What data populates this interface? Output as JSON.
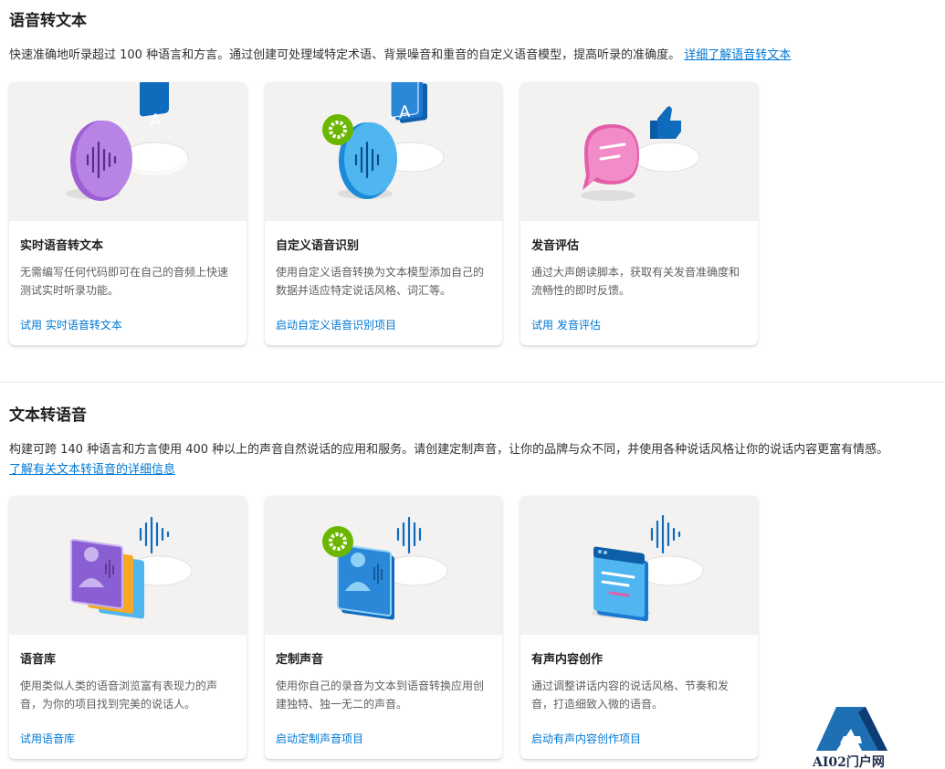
{
  "speech_to_text": {
    "title": "语音转文本",
    "description": "快速准确地听录超过 100 种语言和方言。通过创建可处理域特定术语、背景噪音和重音的自定义语音模型，提高听录的准确度。",
    "learn_more": "详细了解语音转文本",
    "cards": [
      {
        "title": "实时语音转文本",
        "desc": "无需编写任何代码即可在自己的音频上快速测试实时听录功能。",
        "link": "试用 实时语音转文本"
      },
      {
        "title": "自定义语音识别",
        "desc": "使用自定义语音转换为文本模型添加自己的数据并适应特定说话风格、词汇等。",
        "link": "启动自定义语音识别项目"
      },
      {
        "title": "发音评估",
        "desc": "通过大声朗读脚本，获取有关发音准确度和流畅性的即时反馈。",
        "link": "试用 发音评估"
      }
    ]
  },
  "text_to_speech": {
    "title": "文本转语音",
    "description": "构建可跨 140 种语言和方言使用 400 种以上的声音自然说话的应用和服务。请创建定制声音，让你的品牌与众不同，并使用各种说话风格让你的说话内容更富有情感。",
    "learn_more": "了解有关文本转语音的详细信息",
    "cards": [
      {
        "title": "语音库",
        "desc": "使用类似人类的语音浏览富有表现力的声音，为你的项目找到完美的说话人。",
        "link": "试用语音库"
      },
      {
        "title": "定制声音",
        "desc": "使用你自己的录音为文本到语音转换应用创建独特、独一无二的声音。",
        "link": "启动定制声音项目"
      },
      {
        "title": "有声内容创作",
        "desc": "通过调整讲话内容的说话风格、节奏和发音，打造细致入微的语音。",
        "link": "启动有声内容创作项目"
      }
    ]
  },
  "watermark": {
    "text": "AI02门户网"
  },
  "icons": {
    "card1": "purple-waveform-to-letter-a-icon",
    "card2": "gear-waveform-stacked-a-icon",
    "card3": "pink-chat-bubble-thumbs-up-icon",
    "card4": "voice-profile-cards-icon",
    "card5": "gear-voice-profile-icon",
    "card6": "audio-content-window-icon"
  },
  "colors": {
    "accent": "#0078d4",
    "title": "#201f1e",
    "muted": "#605e5c"
  }
}
